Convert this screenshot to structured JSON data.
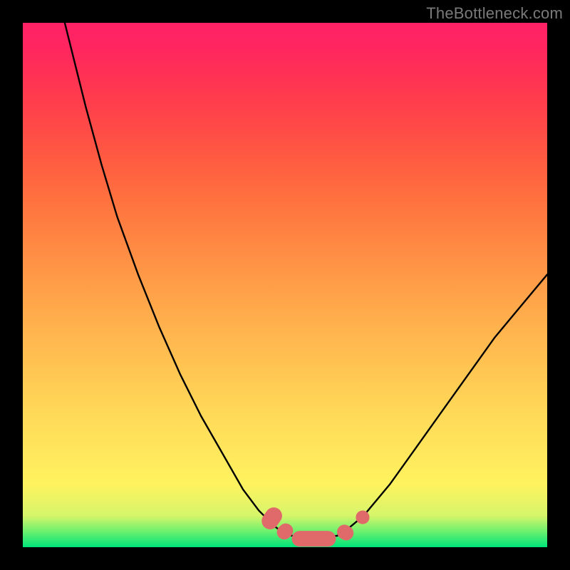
{
  "watermark": {
    "text": "TheBottleneck.com"
  },
  "colors": {
    "frame": "#000000",
    "curve_stroke": "#000000",
    "marker_fill": "#e06a6a",
    "marker_stroke": "#e06a6a",
    "watermark_text": "#7a7a7a"
  },
  "chart_data": {
    "type": "line",
    "title": "",
    "xlabel": "",
    "ylabel": "",
    "xlim": [
      0,
      100
    ],
    "ylim": [
      0,
      100
    ],
    "grid": false,
    "legend": false,
    "series": [
      {
        "name": "bottleneck-curve",
        "x": [
          8,
          10,
          12,
          15,
          18,
          22,
          26,
          30,
          34,
          38,
          42,
          45,
          48,
          50,
          53,
          56,
          60,
          62,
          65,
          70,
          75,
          80,
          85,
          90,
          95,
          100
        ],
        "values": [
          100,
          92,
          84,
          73,
          63,
          52,
          42,
          33,
          25,
          18,
          11,
          7,
          4,
          2.5,
          1.8,
          1.6,
          2.2,
          3.5,
          6,
          12,
          19,
          26,
          33,
          40,
          46,
          52
        ]
      }
    ],
    "markers": [
      {
        "shape": "round-rect",
        "cx": 47.5,
        "cy": 5.5,
        "rx": 2.2,
        "ry": 1.6,
        "rotation": -55
      },
      {
        "shape": "round-rect",
        "cx": 50.0,
        "cy": 3.0,
        "rx": 1.6,
        "ry": 1.4,
        "rotation": -40
      },
      {
        "shape": "round-rect",
        "cx": 55.5,
        "cy": 1.6,
        "rx": 4.2,
        "ry": 1.5,
        "rotation": 0
      },
      {
        "shape": "round-rect",
        "cx": 61.5,
        "cy": 2.8,
        "rx": 1.6,
        "ry": 1.4,
        "rotation": 30
      },
      {
        "shape": "circle",
        "cx": 64.8,
        "cy": 5.7,
        "r": 1.3
      }
    ],
    "annotations": []
  }
}
